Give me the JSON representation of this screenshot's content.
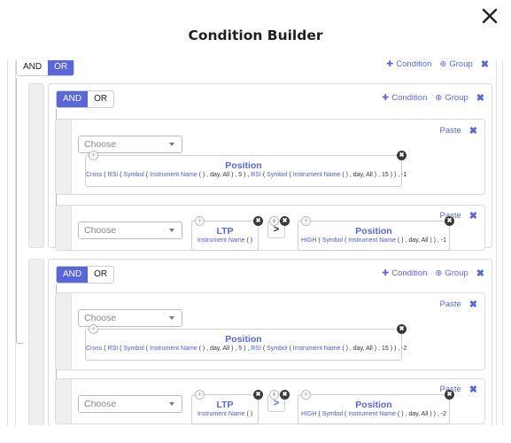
{
  "dialog": {
    "title": "Condition Builder",
    "close_icon": "close-icon"
  },
  "root": {
    "combinator": {
      "and": "AND",
      "or": "OR",
      "selected": "OR"
    },
    "actions": {
      "add_condition": "Condition",
      "add_group": "Group",
      "remove_icon": "times-icon"
    }
  },
  "groups": [
    {
      "combinator": {
        "and": "AND",
        "or": "OR",
        "selected": "AND"
      },
      "actions": {
        "add_condition": "Condition",
        "add_group": "Group"
      },
      "rules": [
        {
          "paste": "Paste",
          "select_placeholder": "Choose",
          "card": {
            "title": "Position",
            "expr": [
              {
                "t": "Cross",
                "f": true
              },
              {
                "t": " ( ",
                "f": false
              },
              {
                "t": "RSI",
                "f": true
              },
              {
                "t": " ( ",
                "f": false
              },
              {
                "t": "Symbol",
                "f": true
              },
              {
                "t": " ( ",
                "f": false
              },
              {
                "t": "Instrument Name",
                "f": true
              },
              {
                "t": " ( ) , day, All ) , 5 ) , ",
                "f": false
              },
              {
                "t": "RSI",
                "f": true
              },
              {
                "t": " ( ",
                "f": false
              },
              {
                "t": "Symbol",
                "f": true
              },
              {
                "t": " ( ",
                "f": false
              },
              {
                "t": "Instrument Name",
                "f": true
              },
              {
                "t": " ( ) , day, All ) , 15 ) ) , -1",
                "f": false
              }
            ]
          }
        },
        {
          "paste": "Paste",
          "select_placeholder": "Choose",
          "left": {
            "title": "LTP",
            "expr": [
              {
                "t": "Instrument Name",
                "f": true
              },
              {
                "t": " ( )",
                "f": false
              }
            ]
          },
          "operator": ">",
          "operator_color": "#222222",
          "right": {
            "title": "Position",
            "expr": [
              {
                "t": "HIGH",
                "f": true
              },
              {
                "t": " ( ",
                "f": false
              },
              {
                "t": "Symbol",
                "f": true
              },
              {
                "t": " ( ",
                "f": false
              },
              {
                "t": "Instrument Name",
                "f": true
              },
              {
                "t": " ( ) , day, All ) ) , -1",
                "f": false
              }
            ]
          }
        }
      ]
    },
    {
      "combinator": {
        "and": "AND",
        "or": "OR",
        "selected": "AND"
      },
      "actions": {
        "add_condition": "Condition",
        "add_group": "Group"
      },
      "rules": [
        {
          "paste": "Paste",
          "select_placeholder": "Choose",
          "card": {
            "title": "Position",
            "expr": [
              {
                "t": "Cross",
                "f": true
              },
              {
                "t": " ( ",
                "f": false
              },
              {
                "t": "RSI",
                "f": true
              },
              {
                "t": " ( ",
                "f": false
              },
              {
                "t": "Symbol",
                "f": true
              },
              {
                "t": " ( ",
                "f": false
              },
              {
                "t": "Instrument Name",
                "f": true
              },
              {
                "t": " ( ) , day, All ) , 5 ) , ",
                "f": false
              },
              {
                "t": "RSI",
                "f": true
              },
              {
                "t": " ( ",
                "f": false
              },
              {
                "t": "Symbol",
                "f": true
              },
              {
                "t": " ( ",
                "f": false
              },
              {
                "t": "Instrument Name",
                "f": true
              },
              {
                "t": " ( ) , day, All ) , 15 ) ) , -2",
                "f": false
              }
            ]
          }
        },
        {
          "paste": "Paste",
          "select_placeholder": "Choose",
          "left": {
            "title": "LTP",
            "expr": [
              {
                "t": "Instrument Name",
                "f": true
              },
              {
                "t": " ( )",
                "f": false
              }
            ]
          },
          "operator": ">",
          "operator_color": "#5a67d8",
          "right": {
            "title": "Position",
            "expr": [
              {
                "t": "HIGH",
                "f": true
              },
              {
                "t": " ( ",
                "f": false
              },
              {
                "t": "Symbol",
                "f": true
              },
              {
                "t": " ( ",
                "f": false
              },
              {
                "t": "Instrument Name",
                "f": true
              },
              {
                "t": " ( ) , day, All ) ) , -2",
                "f": false
              }
            ]
          }
        }
      ]
    }
  ],
  "colors": {
    "accent": "#5a67d8",
    "delete_badge": "#3a3a3a",
    "gutter": "#efefef"
  }
}
